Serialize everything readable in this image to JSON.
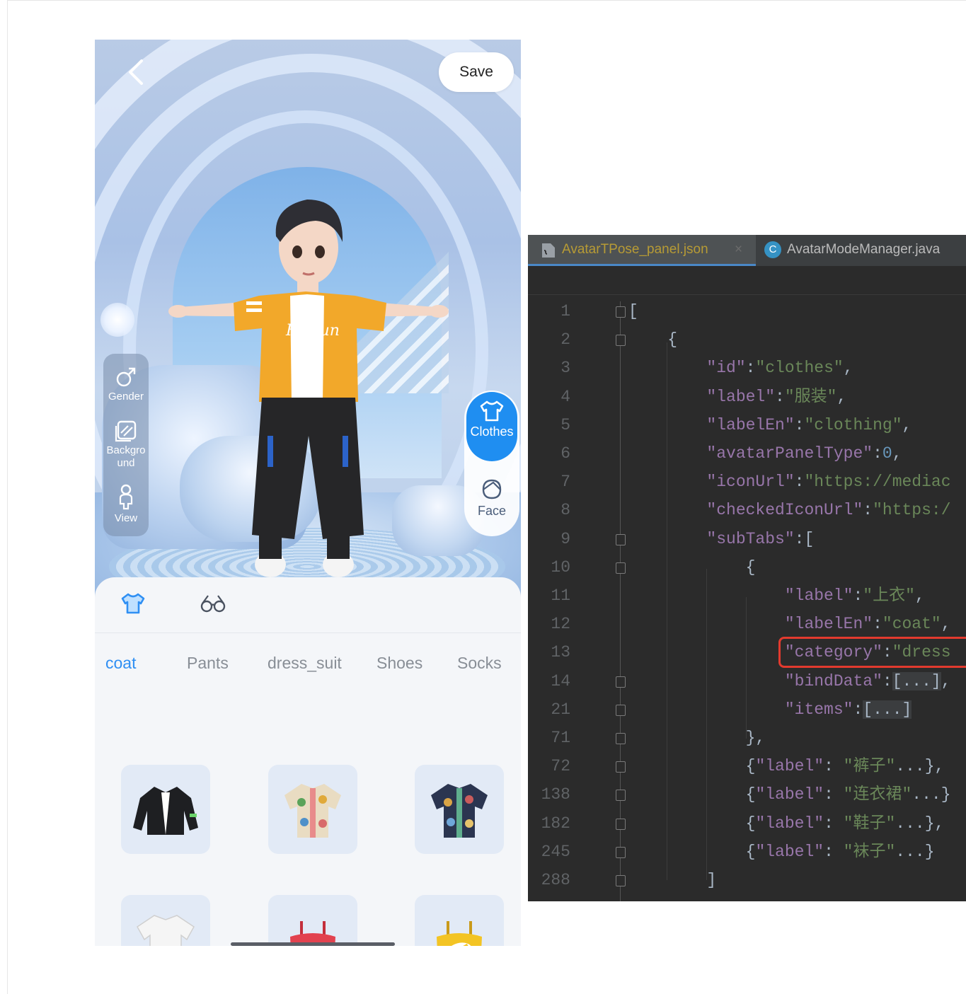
{
  "phone": {
    "save_label": "Save",
    "left_tools": [
      {
        "label": "Gender",
        "icon": "gender-male-icon"
      },
      {
        "label": "Backgro und",
        "icon": "background-icon"
      },
      {
        "label": "View",
        "icon": "person-view-icon"
      }
    ],
    "right_tabs": [
      {
        "label": "Clothes",
        "icon": "tshirt-icon",
        "active": true
      },
      {
        "label": "Face",
        "icon": "face-icon",
        "active": false
      }
    ],
    "category_icons": [
      "tshirt-icon",
      "glasses-icon"
    ],
    "sub_tabs": [
      {
        "label": "coat",
        "active": true
      },
      {
        "label": "Pants",
        "active": false
      },
      {
        "label": "dress_suit",
        "active": false
      },
      {
        "label": "Shoes",
        "active": false
      },
      {
        "label": "Socks",
        "active": false
      }
    ],
    "items": [
      {
        "icon": "black-jacket-icon"
      },
      {
        "icon": "floral-shirt-icon"
      },
      {
        "icon": "dark-floral-shirt-icon"
      },
      {
        "icon": "white-tshirt-icon"
      },
      {
        "icon": "red-heart-top-icon"
      },
      {
        "icon": "yellow-top-icon"
      }
    ],
    "shirt_logo_text": "HaFun",
    "accent": "#2f8ff3"
  },
  "ide": {
    "tabs": [
      {
        "label": "AvatarTPose_panel.json",
        "active": true,
        "icon": "json-file-icon"
      },
      {
        "label": "AvatarModeManager.java",
        "active": false,
        "icon": "java-class-icon"
      }
    ],
    "lines": [
      {
        "n": "1",
        "text": "["
      },
      {
        "n": "2",
        "text": "    {"
      },
      {
        "n": "3",
        "text": "        \"id\":\"clothes\","
      },
      {
        "n": "4",
        "text": "        \"label\":\"服装\","
      },
      {
        "n": "5",
        "text": "        \"labelEn\":\"clothing\","
      },
      {
        "n": "6",
        "text": "        \"avatarPanelType\":0,"
      },
      {
        "n": "7",
        "text": "        \"iconUrl\":\"https://mediac"
      },
      {
        "n": "8",
        "text": "        \"checkedIconUrl\":\"https:/"
      },
      {
        "n": "9",
        "text": "        \"subTabs\":["
      },
      {
        "n": "10",
        "text": "            {"
      },
      {
        "n": "11",
        "text": "                \"label\":\"上衣\","
      },
      {
        "n": "12",
        "text": "                \"labelEn\":\"coat\","
      },
      {
        "n": "13",
        "text": "                \"category\":\"dress"
      },
      {
        "n": "14",
        "text": "                \"bindData\":[...],"
      },
      {
        "n": "21",
        "text": "                \"items\":[...]"
      },
      {
        "n": "71",
        "text": "            },"
      },
      {
        "n": "72",
        "text": "            {\"label\": \"裤子\"...},"
      },
      {
        "n": "138",
        "text": "            {\"label\": \"连衣裙\"...}"
      },
      {
        "n": "182",
        "text": "            {\"label\": \"鞋子\"...},"
      },
      {
        "n": "245",
        "text": "            {\"label\": \"袜子\"...}"
      },
      {
        "n": "288",
        "text": "        ]"
      }
    ],
    "highlight_color": "#e23a2e"
  }
}
